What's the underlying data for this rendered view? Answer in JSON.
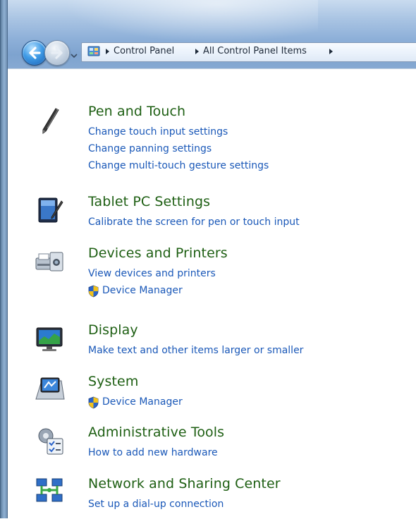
{
  "navigation": {
    "breadcrumbs": [
      "Control Panel",
      "All Control Panel Items"
    ]
  },
  "items": [
    {
      "title": "Pen and Touch",
      "icon": "pen-icon",
      "links": [
        "Change touch input settings",
        "Change panning settings",
        "Change multi-touch gesture settings"
      ]
    },
    {
      "title": "Tablet PC Settings",
      "icon": "tablet-icon",
      "links": [
        "Calibrate the screen for pen or touch input"
      ]
    },
    {
      "title": "Devices and Printers",
      "icon": "printer-icon",
      "links": [
        "View devices and printers",
        "Device Manager"
      ]
    },
    {
      "title": "Display",
      "icon": "monitor-icon",
      "links": [
        "Make text and other items larger or smaller"
      ]
    },
    {
      "title": "System",
      "icon": "system-icon",
      "links": [
        "Device Manager"
      ]
    },
    {
      "title": "Administrative Tools",
      "icon": "admin-tools-icon",
      "links": [
        "How to add new hardware"
      ]
    },
    {
      "title": "Network and Sharing Center",
      "icon": "network-icon",
      "links": [
        "Set up a dial-up connection"
      ]
    }
  ],
  "colors": {
    "title_green": "#1e5f13",
    "link_blue": "#1a58b8"
  }
}
